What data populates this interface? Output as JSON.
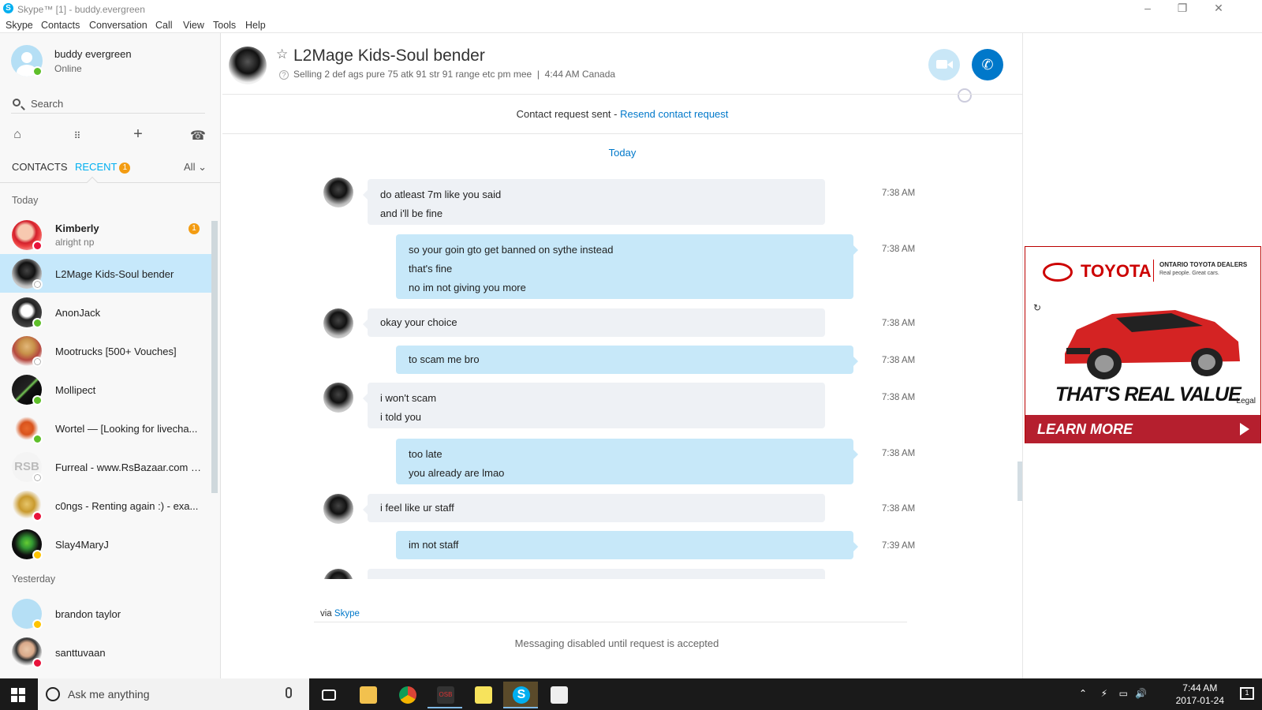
{
  "window": {
    "title": "Skype™ [1] - buddy.evergreen"
  },
  "menu": [
    "Skype",
    "Contacts",
    "Conversation",
    "Call",
    "View",
    "Tools",
    "Help"
  ],
  "profile": {
    "name": "buddy evergreen",
    "status": "Online"
  },
  "search": {
    "placeholder": "Search"
  },
  "tabs": {
    "contacts": "CONTACTS",
    "recent": "RECENT",
    "recent_badge": "1",
    "filter": "All"
  },
  "sections": {
    "today": "Today",
    "yesterday": "Yesterday"
  },
  "recent": [
    {
      "name": "Kimberly",
      "sub": "alright np",
      "badge": "1",
      "status": "busy"
    },
    {
      "name": "L2Mage Kids-Soul bender",
      "sub": "",
      "status": "unknown",
      "active": true
    },
    {
      "name": "AnonJack",
      "sub": "",
      "status": "online"
    },
    {
      "name": "Mootrucks [500+ Vouches]",
      "sub": "",
      "status": "unknown"
    },
    {
      "name": "Mollipect",
      "sub": "",
      "status": "online"
    },
    {
      "name": "Wortel — [Looking for livecha...",
      "sub": "",
      "status": "online"
    },
    {
      "name": "Furreal - www.RsBazaar.com -...",
      "sub": "",
      "status": "unknown"
    },
    {
      "name": "c0ngs - Renting again :) - exa...",
      "sub": "",
      "status": "busy"
    },
    {
      "name": "Slay4MaryJ",
      "sub": "",
      "status": "away"
    }
  ],
  "recent_yesterday": [
    {
      "name": "brandon taylor",
      "status": "away"
    },
    {
      "name": "santtuvaan",
      "status": "busy"
    }
  ],
  "conversation": {
    "title": "L2Mage Kids-Soul bender",
    "mood": "Selling 2 def ags pure 75 atk 91 str 91 range etc pm mee",
    "local_time": "4:44 AM Canada",
    "request_text": "Contact request sent - ",
    "request_link": "Resend contact request",
    "date_separator": "Today",
    "via_text": "via ",
    "via_link": "Skype",
    "disabled_text": "Messaging disabled until request is accepted"
  },
  "messages": [
    {
      "dir": "in",
      "lines": [
        "do atleast 7m like you said",
        "and i'll be fine"
      ],
      "time": "7:38 AM"
    },
    {
      "dir": "out",
      "lines": [
        "so your goin gto get banned on sythe instead",
        "that's fine",
        "no im not giving you more"
      ],
      "time": "7:38 AM"
    },
    {
      "dir": "in",
      "lines": [
        "okay your choice"
      ],
      "time": "7:38 AM"
    },
    {
      "dir": "out",
      "lines": [
        "to scam me bro"
      ],
      "time": "7:38 AM"
    },
    {
      "dir": "in",
      "lines": [
        "i won't scam",
        "i told you"
      ],
      "time": "7:38 AM"
    },
    {
      "dir": "out",
      "lines": [
        "too late",
        "you already are lmao"
      ],
      "time": "7:38 AM"
    },
    {
      "dir": "in",
      "lines": [
        "i feel like ur staff"
      ],
      "time": "7:38 AM"
    },
    {
      "dir": "out",
      "lines": [
        "im not staff"
      ],
      "time": "7:39 AM"
    }
  ],
  "ad": {
    "brand": "TOYOTA",
    "dealer": "ONTARIO TOYOTA DEALERS",
    "dealer_tag": "Real people. Great cars.",
    "tagline": "THAT'S REAL VALUE",
    "legal": "Legal",
    "cta": "LEARN MORE"
  },
  "taskbar": {
    "search_placeholder": "Ask me anything",
    "time": "7:44 AM",
    "date": "2017-01-24",
    "notifications": "1"
  }
}
